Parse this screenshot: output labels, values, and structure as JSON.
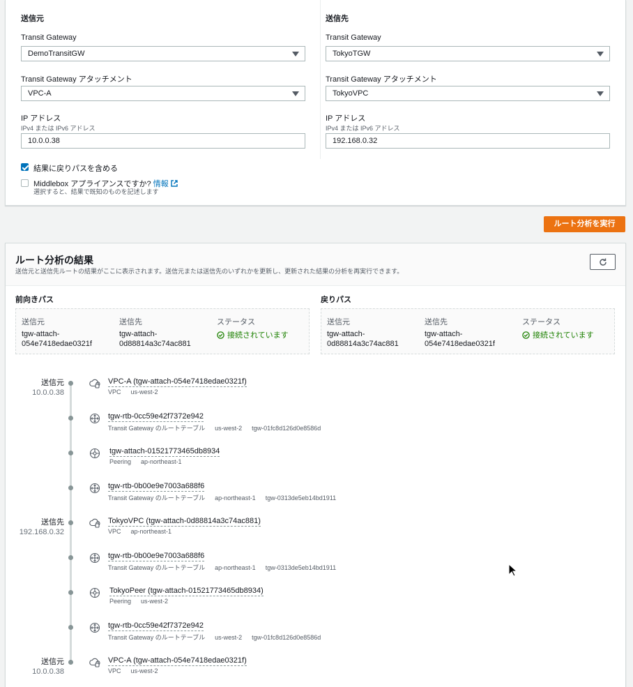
{
  "source": {
    "heading": "送信元",
    "tgw_label": "Transit Gateway",
    "tgw_value": "DemoTransitGW",
    "attach_label": "Transit Gateway アタッチメント",
    "attach_value": "VPC-A",
    "ip_label": "IP アドレス",
    "ip_desc": "IPv4 または IPv6 アドレス",
    "ip_value": "10.0.0.38"
  },
  "destination": {
    "heading": "送信先",
    "tgw_label": "Transit Gateway",
    "tgw_value": "TokyoTGW",
    "attach_label": "Transit Gateway アタッチメント",
    "attach_value": "TokyoVPC",
    "ip_label": "IP アドレス",
    "ip_desc": "IPv4 または IPv6 アドレス",
    "ip_value": "192.168.0.32"
  },
  "options": {
    "return_path_label": "結果に戻りパスを含める",
    "return_path_checked": true,
    "middlebox_label": "Middlebox アプライアンスですか?",
    "middlebox_info": "情報",
    "middlebox_desc": "選択すると、結果で既知のものを記述します",
    "middlebox_checked": false
  },
  "run_button": "ルート分析を実行",
  "results": {
    "title": "ルート分析の結果",
    "description": "送信元と送信先ルートの結果がここに表示されます。送信元または送信先のいずれかを更新し、更新された結果の分析を再実行できます。",
    "forward": {
      "heading": "前向きパス",
      "col_source": "送信元",
      "col_dest": "送信先",
      "col_status": "ステータス",
      "source_line1": "tgw-attach-",
      "source_line2": "054e7418edae0321f",
      "dest_line1": "tgw-attach-",
      "dest_line2": "0d88814a3c74ac881",
      "status": "接続されています"
    },
    "return": {
      "heading": "戻りパス",
      "col_source": "送信元",
      "col_dest": "送信先",
      "col_status": "ステータス",
      "source_line1": "tgw-attach-",
      "source_line2": "0d88814a3c74ac881",
      "dest_line1": "tgw-attach-",
      "dest_line2": "054e7418edae0321f",
      "status": "接続されています"
    }
  },
  "timeline": [
    {
      "side": "送信元",
      "ip": "10.0.0.38",
      "icon": "vpc-icon",
      "title": "VPC-A (tgw-attach-054e7418edae0321f)",
      "meta": [
        "VPC",
        "us-west-2"
      ]
    },
    {
      "side": "",
      "ip": "",
      "icon": "route-table-icon",
      "title": "tgw-rtb-0cc59e42f7372e942",
      "meta": [
        "Transit Gateway のルートテーブル",
        "us-west-2",
        "tgw-01fc8d126d0e8586d"
      ]
    },
    {
      "side": "",
      "ip": "",
      "icon": "peering-icon",
      "title": "tgw-attach-01521773465db8934",
      "meta": [
        "Peering",
        "ap-northeast-1"
      ]
    },
    {
      "side": "",
      "ip": "",
      "icon": "route-table-icon",
      "title": "tgw-rtb-0b00e9e7003a688f6",
      "meta": [
        "Transit Gateway のルートテーブル",
        "ap-northeast-1",
        "tgw-0313de5eb14bd1911"
      ]
    },
    {
      "side": "送信先",
      "ip": "192.168.0.32",
      "icon": "vpc-icon",
      "title": "TokyoVPC (tgw-attach-0d88814a3c74ac881)",
      "meta": [
        "VPC",
        "ap-northeast-1"
      ]
    },
    {
      "side": "",
      "ip": "",
      "icon": "route-table-icon",
      "title": "tgw-rtb-0b00e9e7003a688f6",
      "meta": [
        "Transit Gateway のルートテーブル",
        "ap-northeast-1",
        "tgw-0313de5eb14bd1911"
      ]
    },
    {
      "side": "",
      "ip": "",
      "icon": "peering-icon",
      "title": "TokyoPeer (tgw-attach-01521773465db8934)",
      "meta": [
        "Peering",
        "us-west-2"
      ]
    },
    {
      "side": "",
      "ip": "",
      "icon": "route-table-icon",
      "title": "tgw-rtb-0cc59e42f7372e942",
      "meta": [
        "Transit Gateway のルートテーブル",
        "us-west-2",
        "tgw-01fc8d126d0e8586d"
      ]
    },
    {
      "side": "送信元",
      "ip": "10.0.0.38",
      "icon": "vpc-icon",
      "title": "VPC-A (tgw-attach-054e7418edae0321f)",
      "meta": [
        "VPC",
        "us-west-2"
      ]
    }
  ],
  "colors": {
    "accent": "#ec7211",
    "link": "#0073bb",
    "success": "#1d8102"
  }
}
